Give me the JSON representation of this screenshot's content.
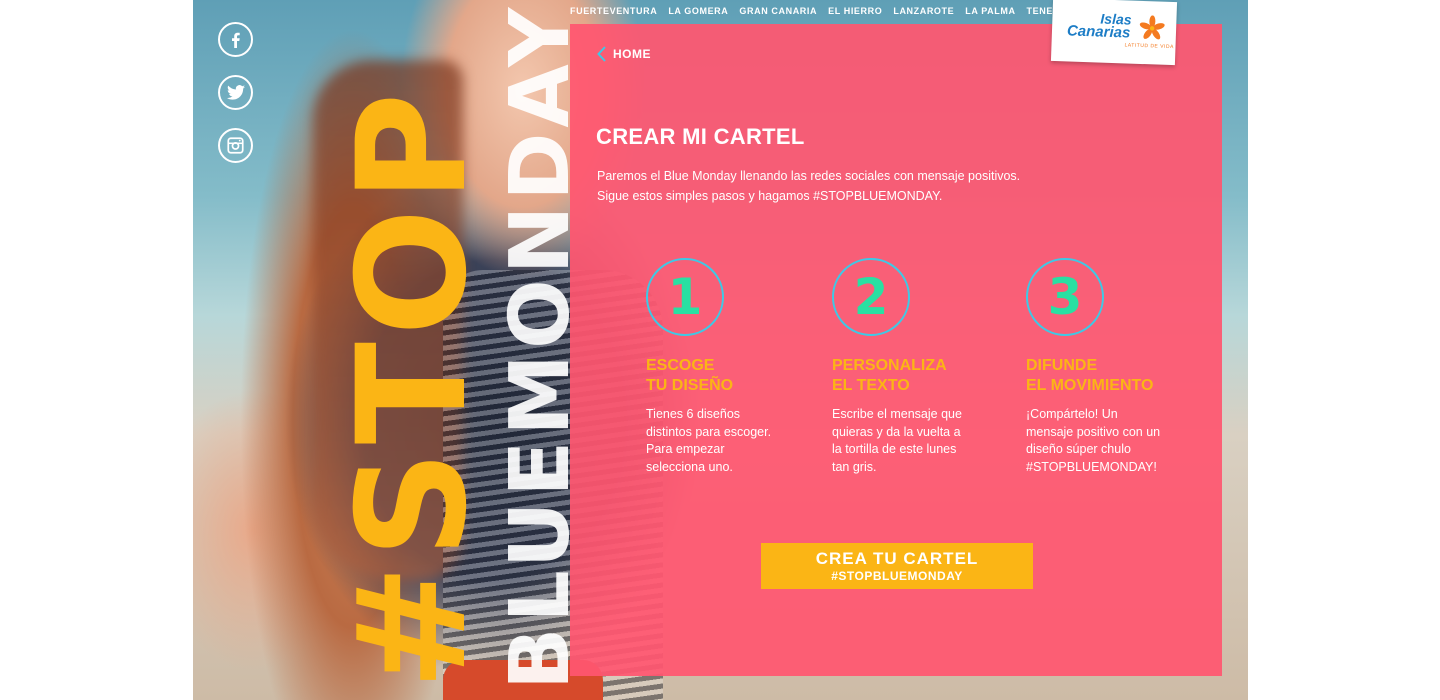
{
  "social": {
    "facebook_icon": "facebook-icon",
    "twitter_icon": "twitter-icon",
    "instagram_icon": "instagram-icon"
  },
  "hero": {
    "stop_text": "#STOP",
    "bluemonday_text": "BLUEMONDAY"
  },
  "topnav": {
    "items": [
      "FUERTEVENTURA",
      "LA GOMERA",
      "GRAN CANARIA",
      "EL HIERRO",
      "LANZAROTE",
      "LA PALMA",
      "TENERIFE"
    ]
  },
  "logo": {
    "line1": "Islas",
    "line2": "Canarias",
    "tagline": "LATITUD DE VIDA"
  },
  "panel": {
    "home_label": "HOME",
    "title": "CREAR MI CARTEL",
    "intro_line1": "Paremos el Blue Monday llenando las redes sociales con mensaje positivos.",
    "intro_line2": "Sigue estos simples pasos y hagamos #STOPBLUEMONDAY."
  },
  "steps": [
    {
      "number": "1",
      "title_line1": "ESCOGE",
      "title_line2": "TU DISEÑO",
      "text": "Tienes 6 diseños distintos para escoger. Para empezar selecciona uno."
    },
    {
      "number": "2",
      "title_line1": "PERSONALIZA",
      "title_line2": "EL TEXTO",
      "text": "Escribe el mensaje que quieras y da la vuelta a la tortilla de este lunes tan gris."
    },
    {
      "number": "3",
      "title_line1": "DIFUNDE",
      "title_line2": "EL MOVIMIENTO",
      "text": "¡Compártelo! Un mensaje positivo con un diseño súper chulo #STOPBLUEMONDAY!"
    }
  ],
  "cta": {
    "line1": "CREA TU CARTEL",
    "line2": "#STOPBLUEMONDAY"
  },
  "colors": {
    "panel": "#ff5670",
    "accent_yellow": "#fbb515",
    "number_green": "#29e0a2",
    "circle_blue": "#3ec9e6",
    "logo_blue": "#1d7dc6"
  }
}
